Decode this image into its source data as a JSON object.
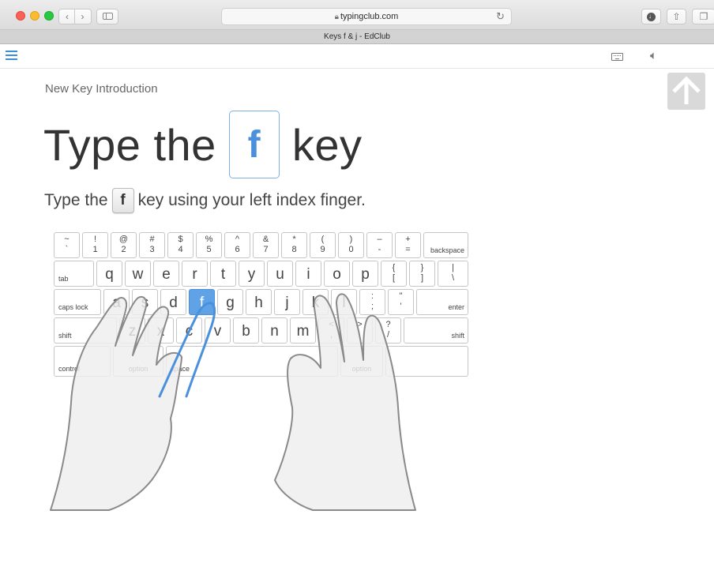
{
  "browser": {
    "url": "typingclub.com",
    "tab_title": "Keys f & j - EdClub",
    "back_icon": "chevron-left-icon",
    "forward_icon": "chevron-right-icon",
    "reload_icon": "reload-icon"
  },
  "lesson": {
    "subtitle": "New Key Introduction",
    "headline_before": "Type the",
    "headline_key": "f",
    "headline_after": "key",
    "instruction_before": "Type the",
    "instruction_key": "f",
    "instruction_after": "key using your left index finger."
  },
  "keyboard": {
    "row1": [
      {
        "top": "~",
        "bottom": "`"
      },
      {
        "top": "!",
        "bottom": "1"
      },
      {
        "top": "@",
        "bottom": "2"
      },
      {
        "top": "#",
        "bottom": "3"
      },
      {
        "top": "$",
        "bottom": "4"
      },
      {
        "top": "%",
        "bottom": "5"
      },
      {
        "top": "^",
        "bottom": "6"
      },
      {
        "top": "&",
        "bottom": "7"
      },
      {
        "top": "*",
        "bottom": "8"
      },
      {
        "top": "(",
        "bottom": "9"
      },
      {
        "top": ")",
        "bottom": "0"
      },
      {
        "top": "–",
        "bottom": "-"
      },
      {
        "top": "+",
        "bottom": "="
      }
    ],
    "backspace": "backspace",
    "tab": "tab",
    "row2": [
      "q",
      "w",
      "e",
      "r",
      "t",
      "y",
      "u",
      "i",
      "o",
      "p"
    ],
    "row2_symbols": [
      {
        "top": "{",
        "bottom": "["
      },
      {
        "top": "}",
        "bottom": "]"
      },
      {
        "top": "|",
        "bottom": "\\"
      }
    ],
    "caps_lock": "caps lock",
    "row3": [
      "a",
      "s",
      "d",
      "f",
      "g",
      "h",
      "j",
      "k",
      "l"
    ],
    "row3_symbols": [
      {
        "top": ":",
        "bottom": ";"
      },
      {
        "top": "\"",
        "bottom": "'"
      }
    ],
    "enter": "enter",
    "shift_left": "shift",
    "row4": [
      "z",
      "x",
      "c",
      "v",
      "b",
      "n",
      "m"
    ],
    "row4_symbols": [
      {
        "top": "<",
        "bottom": ","
      },
      {
        "top": ">",
        "bottom": "."
      },
      {
        "top": "?",
        "bottom": "/"
      }
    ],
    "shift_right": "shift",
    "control": "control",
    "option_left": "option",
    "space": "space",
    "option_right": "option",
    "active_key": "f"
  },
  "colors": {
    "accent": "#4a90dc",
    "active_key": "#5fa3e6",
    "text": "#333333"
  },
  "icons": {
    "menu": "hamburger-menu-icon",
    "keyboard": "keyboard-icon",
    "sound": "speaker-icon",
    "scroll_top": "arrow-up-icon"
  }
}
